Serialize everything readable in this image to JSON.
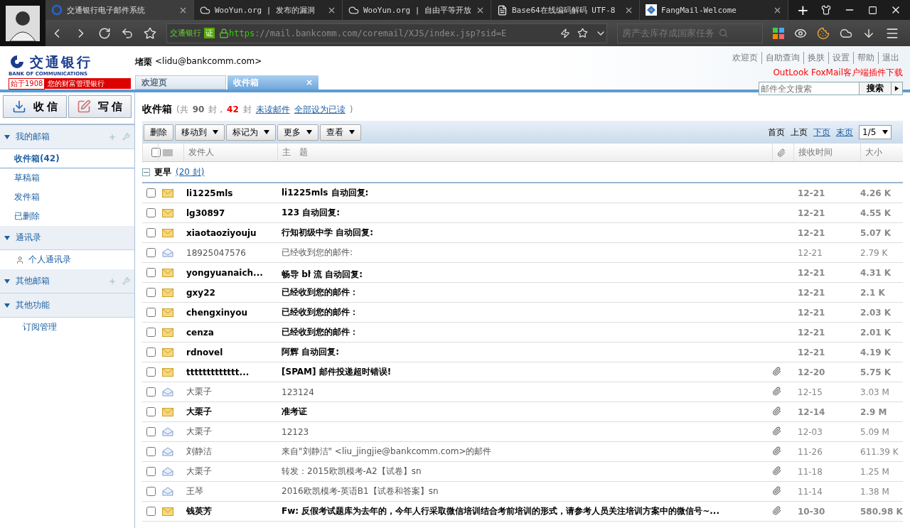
{
  "browser": {
    "tabs": [
      {
        "title": "交通银行电子邮件系统",
        "selected": true,
        "kind": "bank"
      },
      {
        "title": "WooYun.org | 发布的漏洞",
        "selected": false,
        "kind": "cloud"
      },
      {
        "title": "WooYun.org | 自由平等开放",
        "selected": false,
        "kind": "cloud"
      },
      {
        "title": "Base64在线编码解码 UTF-8",
        "selected": false,
        "kind": "page"
      },
      {
        "title": "FangMail-Welcome",
        "selected": false,
        "kind": "diamond"
      }
    ],
    "new_tab": "+",
    "site_label": "交通银行",
    "site_badge": "证",
    "url_scheme": "https",
    "url_rest": "://mail.bankcomm.com/coremail/XJS/index.jsp?sid=E",
    "search_placeholder": "房产去库存成国家任务"
  },
  "header": {
    "logo_cn": "交通银行",
    "logo_en": "BANK OF COMMUNICATIONS",
    "slogan_year": "始于1908",
    "slogan": "您的财富管理银行",
    "user_name": "堵栗",
    "user_email": "<lidu@bankcomm.com>",
    "links": [
      "欢迎页",
      "自助查询",
      "换肤",
      "设置",
      "帮助",
      "退出"
    ],
    "plugin_link": "OutLook FoxMail客户端插件下载",
    "search_placeholder": "邮件全文搜索",
    "search_button": "搜索",
    "tabs": [
      {
        "label": "欢迎页",
        "selected": false,
        "closable": false
      },
      {
        "label": "收件箱",
        "selected": true,
        "closable": true
      }
    ],
    "close_mark": "×"
  },
  "actions": [
    {
      "label": "收 信",
      "kind": "receive"
    },
    {
      "label": "写 信",
      "kind": "compose"
    }
  ],
  "sidebar": [
    {
      "title": "我的邮箱",
      "expanded": true,
      "tools": true,
      "items": [
        {
          "label": "收件箱(42)",
          "selected": true,
          "kind": "plain"
        },
        {
          "label": "草稿箱",
          "selected": false,
          "kind": "plain"
        },
        {
          "label": "发件箱",
          "selected": false,
          "kind": "plain"
        },
        {
          "label": "已删除",
          "selected": false,
          "kind": "plain"
        }
      ]
    },
    {
      "title": "通讯录",
      "expanded": true,
      "tools": false,
      "items": [
        {
          "label": "个人通讯录",
          "selected": false,
          "kind": "contact"
        }
      ]
    },
    {
      "title": "其他邮箱",
      "expanded": true,
      "tools": true
    },
    {
      "title": "其他功能",
      "expanded": true,
      "tools": false,
      "items": [
        {
          "label": "订阅管理",
          "selected": false,
          "kind": "indent"
        }
      ]
    }
  ],
  "folder": {
    "title": "收件箱",
    "prefix": "(共",
    "total": "90",
    "mid": "封 ,",
    "unread": "42",
    "unit": "封",
    "unread_link": "未读邮件",
    "mark_all_link": "全部设为已读",
    "suffix": ")"
  },
  "toolbar": [
    {
      "label": "删除",
      "dropdown": false
    },
    {
      "label": "移动到",
      "dropdown": true
    },
    {
      "label": "标记为",
      "dropdown": true
    },
    {
      "label": "更多",
      "dropdown": true
    },
    {
      "label": "查看",
      "dropdown": true
    }
  ],
  "pager": {
    "links": [
      {
        "label": "首页",
        "disabled": true
      },
      {
        "label": "上页",
        "disabled": true
      },
      {
        "label": "下页",
        "disabled": false
      },
      {
        "label": "末页",
        "disabled": false
      }
    ],
    "page": "1/5"
  },
  "select_all": {
    "checked": false
  },
  "columns": {
    "sender": "发件人",
    "subject": "主　题",
    "time": "接收时间",
    "size": "大小"
  },
  "group": {
    "label": "更早",
    "count": "(20 封)",
    "expanded": true
  },
  "messages": [
    {
      "sender": "li1225mls",
      "subject": "li1225mls 自动回复:",
      "attachment": false,
      "time": "12-21",
      "size": "4.26 K",
      "unread": true
    },
    {
      "sender": "lg30897",
      "subject": "123 自动回复:",
      "attachment": false,
      "time": "12-21",
      "size": "4.55 K",
      "unread": true
    },
    {
      "sender": "xiaotaoziyouju",
      "subject": "行知初级中学 自动回复:",
      "attachment": false,
      "time": "12-21",
      "size": "5.07 K",
      "unread": true
    },
    {
      "sender": "18925047576",
      "subject": "已经收到您的邮件:",
      "attachment": false,
      "time": "12-21",
      "size": "2.79 K",
      "unread": false
    },
    {
      "sender": "yongyuanaich...",
      "subject": "畅导ᡃ blᡃ 流 自动回复:",
      "attachment": false,
      "time": "12-21",
      "size": "4.31 K",
      "unread": true
    },
    {
      "sender": "gxy22",
      "subject": "已经收到您的邮件：",
      "attachment": false,
      "time": "12-21",
      "size": "2.1 K",
      "unread": true
    },
    {
      "sender": "chengxinyou",
      "subject": "已经收到您的邮件：",
      "attachment": false,
      "time": "12-21",
      "size": "2.03 K",
      "unread": true
    },
    {
      "sender": "cenza",
      "subject": "已经收到您的邮件：",
      "attachment": false,
      "time": "12-21",
      "size": "2.01 K",
      "unread": true
    },
    {
      "sender": "rdnovel",
      "subject": "阿辉 自动回复:",
      "attachment": false,
      "time": "12-21",
      "size": "4.19 K",
      "unread": true
    },
    {
      "sender": "ttttttttttttt...",
      "subject": "[SPAM] 邮件投递超时错误!",
      "attachment": true,
      "time": "12-20",
      "size": "5.75 K",
      "unread": true
    },
    {
      "sender": "大栗子",
      "subject": "123124",
      "attachment": true,
      "time": "12-15",
      "size": "3.03 M",
      "unread": false
    },
    {
      "sender": "大栗子",
      "subject": "准考证",
      "attachment": true,
      "time": "12-14",
      "size": "2.9 M",
      "unread": true
    },
    {
      "sender": "大栗子",
      "subject": "12123",
      "attachment": true,
      "time": "12-03",
      "size": "5.09 M",
      "unread": false
    },
    {
      "sender": "刘静洁",
      "subject": "来自\"刘静洁\" <liu_jingjie@bankcomm.com>的邮件",
      "attachment": true,
      "time": "11-26",
      "size": "611.39 K",
      "unread": false
    },
    {
      "sender": "大栗子",
      "subject": "转发：2015欧凯模考-A2【试卷】sn",
      "attachment": true,
      "time": "11-18",
      "size": "1.25 M",
      "unread": false
    },
    {
      "sender": "王琴",
      "subject": "2016欧凯模考-英语B1【试卷和答案】sn",
      "attachment": true,
      "time": "11-14",
      "size": "1.38 M",
      "unread": false
    },
    {
      "sender": "钱英芳",
      "subject": "Fw: 反假考试题库为去年的，今年人行采取微信培训结合考前培训的形式，请参考人员关注培训方案中的微信号~...",
      "attachment": true,
      "time": "10-30",
      "size": "580.98 K",
      "unread": true
    }
  ]
}
